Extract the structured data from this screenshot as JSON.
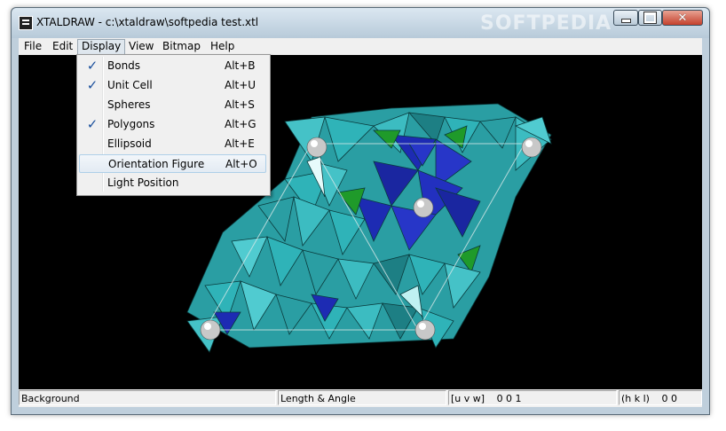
{
  "window": {
    "title": "XTALDRAW - c:\\xtaldraw\\softpedia test.xtl",
    "watermark": "SOFTPEDIA",
    "controls": {
      "minimize": "minimize",
      "maximize": "maximize",
      "close": "✕"
    }
  },
  "menubar": {
    "items": [
      {
        "label": "File"
      },
      {
        "label": "Edit"
      },
      {
        "label": "Display",
        "active": true
      },
      {
        "label": "View"
      },
      {
        "label": "Bitmap"
      },
      {
        "label": "Help"
      }
    ]
  },
  "display_menu": {
    "items": [
      {
        "label": "Bonds",
        "shortcut": "Alt+B",
        "checked": true
      },
      {
        "label": "Unit Cell",
        "shortcut": "Alt+U",
        "checked": true
      },
      {
        "label": "Spheres",
        "shortcut": "Alt+S",
        "checked": false
      },
      {
        "label": "Polygons",
        "shortcut": "Alt+G",
        "checked": true
      },
      {
        "label": "Ellipsoid",
        "shortcut": "Alt+E",
        "checked": false
      },
      {
        "label": "Orientation Figure",
        "shortcut": "Alt+O",
        "checked": false,
        "highlighted": true
      },
      {
        "label": "Light Position",
        "shortcut": "",
        "checked": false
      }
    ],
    "check_glyph": "✓"
  },
  "statusbar": {
    "background": "Background",
    "length_angle": "Length & Angle",
    "uvw_label": "[u v w]",
    "uvw_values": "0   0   1",
    "hkl_label": "(h k l)",
    "hkl_values": "0   0"
  },
  "colors": {
    "viewport_bg": "#000000",
    "polyhedra_teal": "#2fb3b8",
    "polyhedra_blue": "#1d2bb3",
    "polyhedra_green": "#1f9a2a",
    "menu_check": "#1a4f9c"
  }
}
